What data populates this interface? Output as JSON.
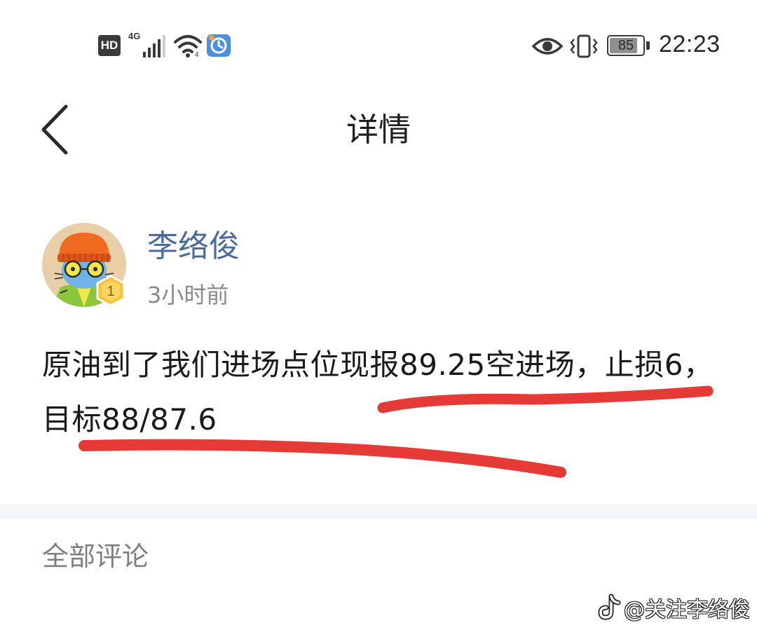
{
  "status_bar": {
    "hd_label": "HD",
    "network_label": "4G",
    "battery_level": "85",
    "battery_fraction": 0.85,
    "time": "22:23"
  },
  "nav": {
    "title": "详情"
  },
  "post": {
    "author": "李络俊",
    "time_ago": "3小时前",
    "level": "1",
    "body": "原油到了我们进场点位现报89.25空进场，止损6，目标88/87.6"
  },
  "comments": {
    "header": "全部评论"
  },
  "watermark": {
    "text": "@关注李络俊"
  },
  "colors": {
    "author_name": "#4a6b9a",
    "underline": "#e53a35",
    "divider": "#f4f5f7"
  }
}
